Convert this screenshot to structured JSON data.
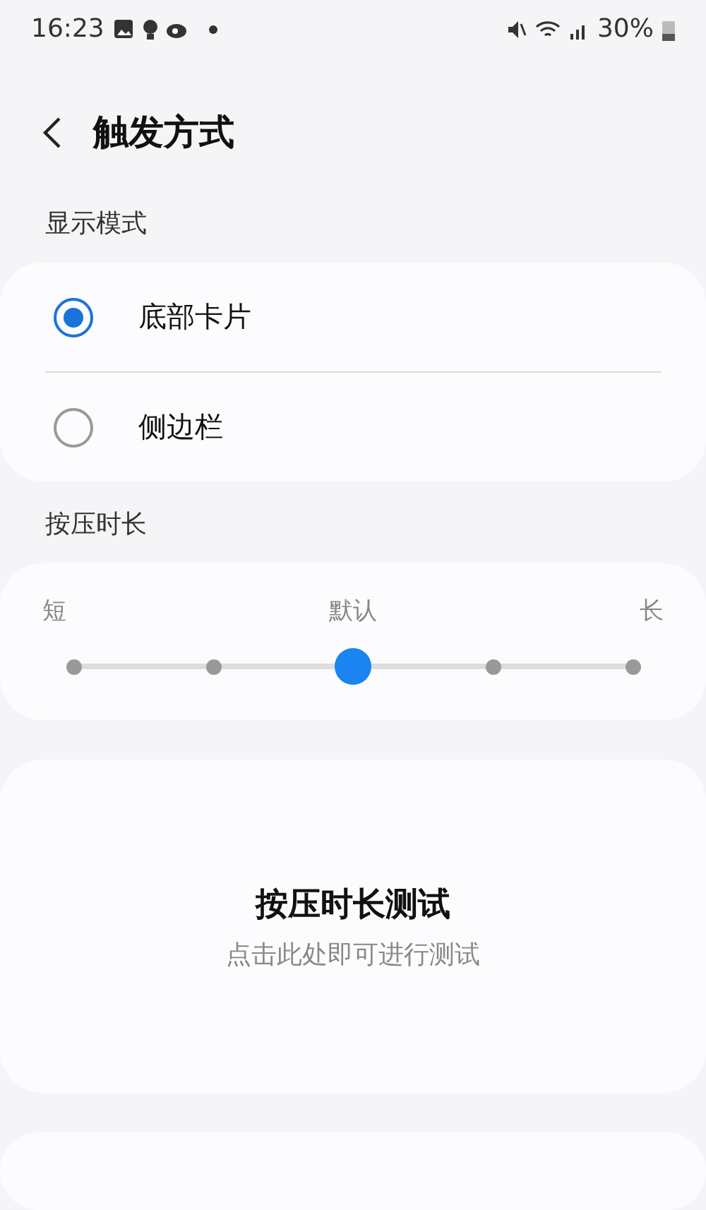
{
  "status_bar": {
    "time": "16:23",
    "battery": "30%"
  },
  "header": {
    "title": "触发方式"
  },
  "display_mode": {
    "label": "显示模式",
    "options": [
      {
        "label": "底部卡片",
        "selected": true
      },
      {
        "label": "侧边栏",
        "selected": false
      }
    ]
  },
  "press_duration": {
    "label": "按压时长",
    "labels": [
      "短",
      "默认",
      "长"
    ],
    "level": 0.5
  },
  "test_card": {
    "title": "按压时长测试",
    "subtitle": "点击此处即可进行测试"
  }
}
